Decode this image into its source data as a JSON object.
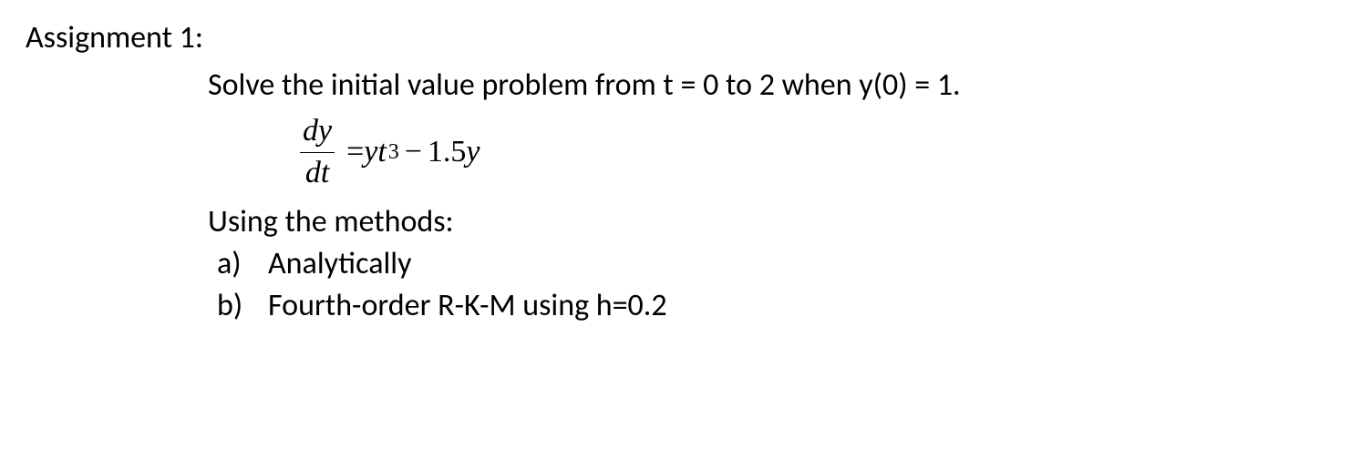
{
  "title": "Assignment 1:",
  "problem_statement": "Solve the initial value problem from t = 0 to 2 when y(0) = 1.",
  "equation": {
    "numerator": "dy",
    "denominator": "dt",
    "rhs_part1": "yt",
    "rhs_exponent": "3",
    "rhs_part2": "1.5",
    "rhs_part3": "y",
    "equals": " = ",
    "minus": "−"
  },
  "methods_intro": "Using the methods:",
  "items": [
    {
      "marker": "a)",
      "text": "Analytically"
    },
    {
      "marker": "b)",
      "text": "Fourth-order R-K-M using h=0.2"
    }
  ]
}
